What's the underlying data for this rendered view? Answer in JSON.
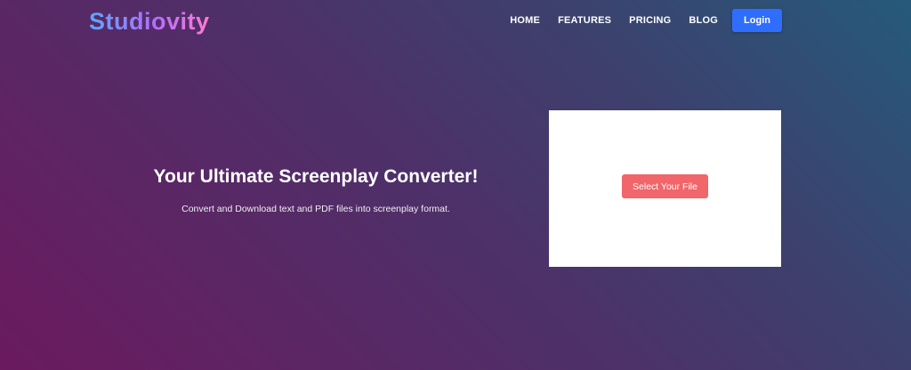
{
  "header": {
    "logo_text": "Studiovity",
    "nav": [
      {
        "label": "HOME"
      },
      {
        "label": "FEATURES"
      },
      {
        "label": "PRICING"
      },
      {
        "label": "BLOG"
      }
    ],
    "login_label": "Login"
  },
  "hero": {
    "title": "Your Ultimate Screenplay Converter!",
    "subtitle": "Convert and Download text and PDF files into screenplay format."
  },
  "upload": {
    "button_label": "Select Your File"
  },
  "colors": {
    "login_button": "#2f6dff",
    "select_button": "#f0666a",
    "card_background": "#ffffff"
  }
}
